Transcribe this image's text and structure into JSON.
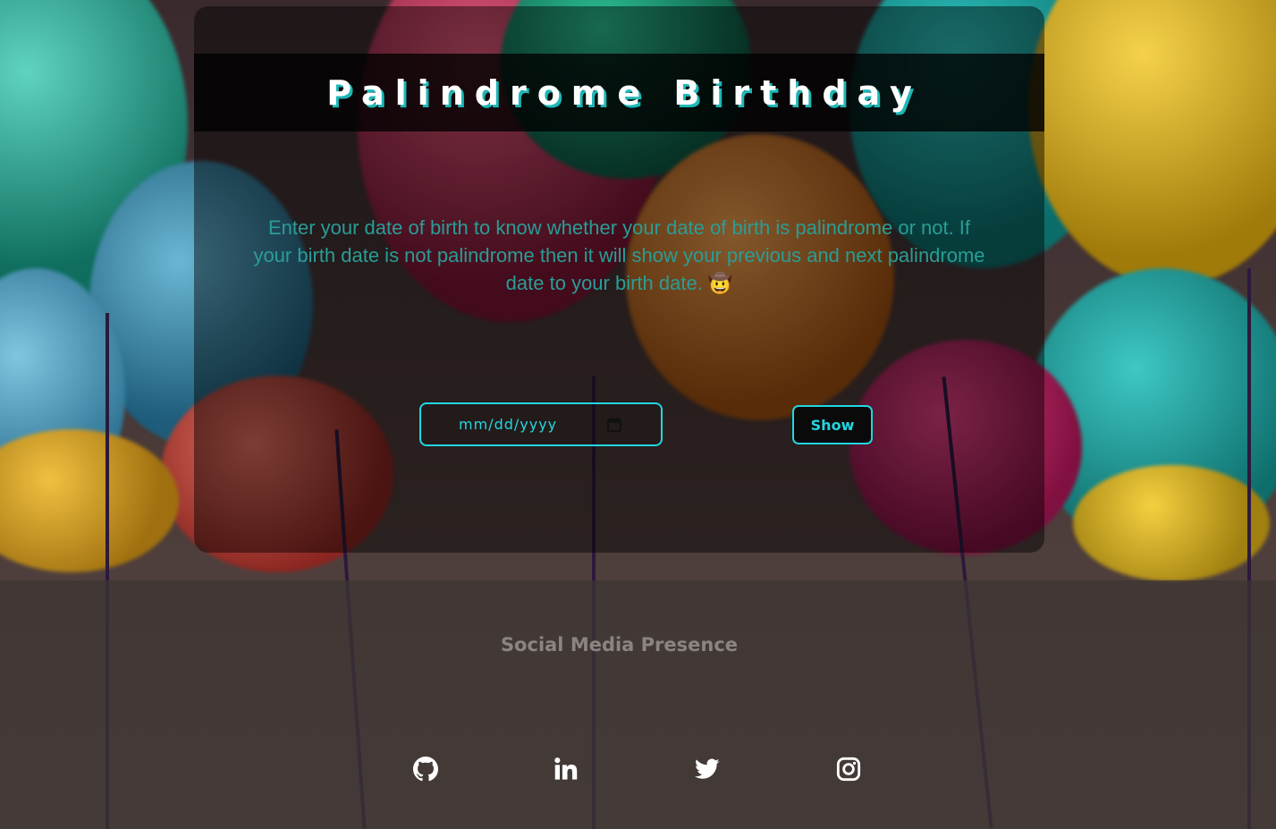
{
  "header": {
    "title": "Palindrome Birthday"
  },
  "main": {
    "description": "Enter your date of birth to know whether your date of birth is palindrome or not. If your birth date is not palindrome then it will show your previous and next palindrome date to your birth date. 🤠",
    "date_input": {
      "placeholder": "mm/dd/yyyy",
      "value": ""
    },
    "show_button": "Show"
  },
  "footer": {
    "title": "Social Media Presence",
    "links": [
      {
        "icon": "github-icon"
      },
      {
        "icon": "linkedin-icon"
      },
      {
        "icon": "twitter-icon"
      },
      {
        "icon": "instagram-icon"
      }
    ]
  },
  "colors": {
    "accent": "#22d6e0",
    "title_shadow": "#1fb7b7",
    "description": "#2a9d96",
    "footer_text": "#8a8482"
  }
}
